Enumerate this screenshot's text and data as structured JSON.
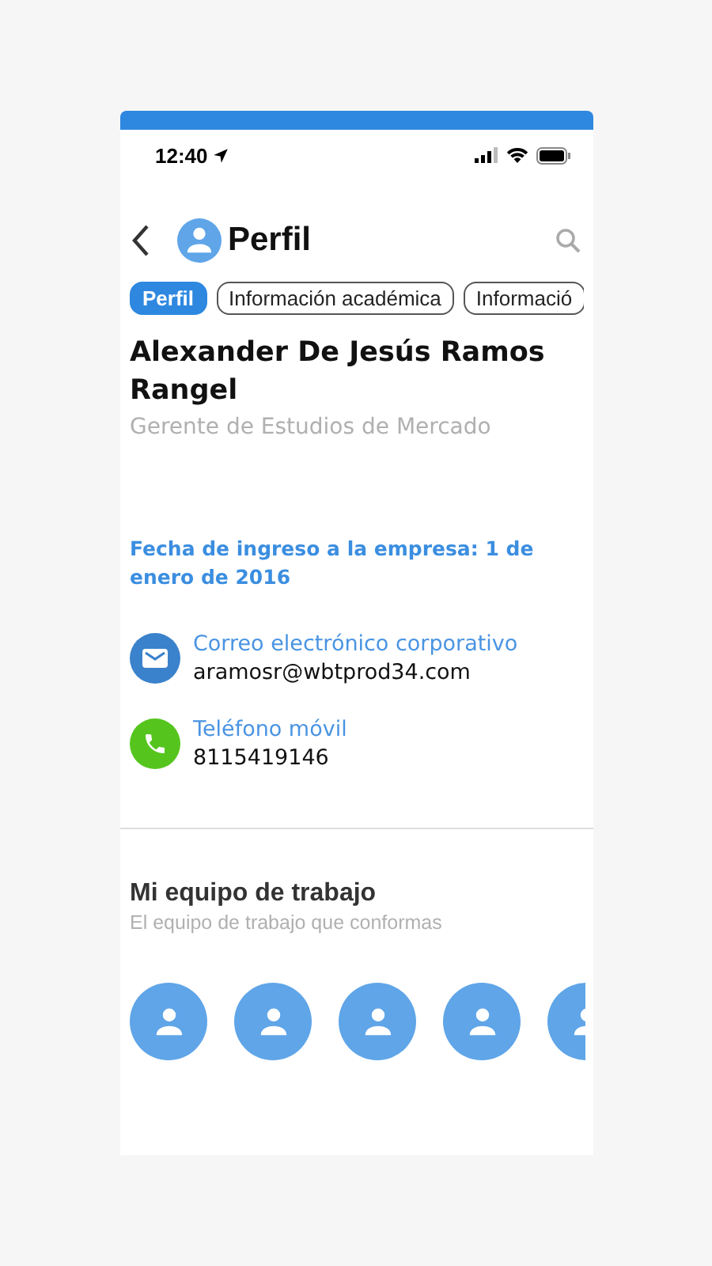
{
  "status_bar": {
    "time": "12:40"
  },
  "header": {
    "title": "Perfil"
  },
  "tabs": [
    {
      "label": "Perfil",
      "selected": true
    },
    {
      "label": "Información académica",
      "selected": false
    },
    {
      "label": "Informació",
      "selected": false
    }
  ],
  "profile": {
    "name": "Alexander De Jesús Ramos Rangel",
    "role": "Gerente de Estudios de Mercado",
    "hire_date": "Fecha de ingreso a la empresa: 1 de enero de 2016"
  },
  "contacts": [
    {
      "kind": "email",
      "label": "Correo electrónico corporativo",
      "value": "aramosr@wbtprod34.com"
    },
    {
      "kind": "phone",
      "label": "Teléfono móvil",
      "value": "8115419146"
    }
  ],
  "team": {
    "title": "Mi equipo de trabajo",
    "subtitle": "El equipo de trabajo que conformas",
    "members": [
      {
        "kind": "avatar"
      },
      {
        "kind": "avatar"
      },
      {
        "kind": "avatar"
      },
      {
        "kind": "avatar"
      },
      {
        "kind": "avatar"
      }
    ]
  }
}
